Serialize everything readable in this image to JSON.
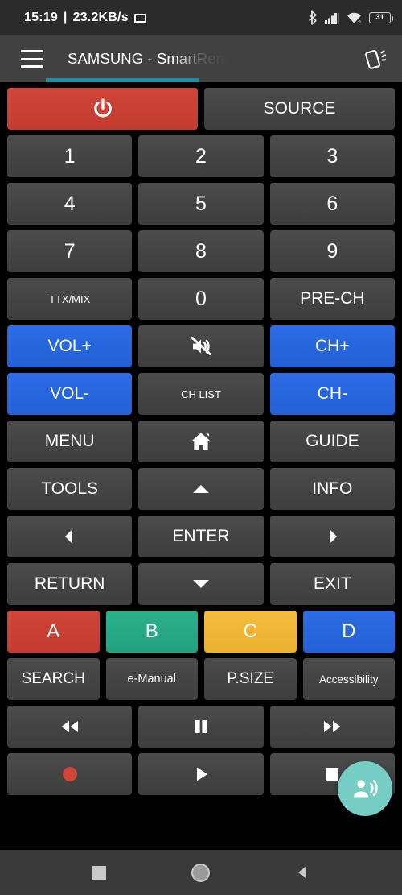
{
  "status_bar": {
    "time": "15:19",
    "separator": "|",
    "network_speed": "23.2KB/s",
    "screen_icon": "screen-cast-icon",
    "bluetooth_icon": "bluetooth-icon",
    "signal_icon": "cellular-signal-icon",
    "wifi_icon": "wifi-icon",
    "battery_level": "31"
  },
  "toolbar": {
    "menu_icon": "hamburger-menu-icon",
    "title": "SAMSUNG - SmartRem",
    "action_icon": "remote-cards-icon",
    "tab_indicator_color": "#1d8fa8"
  },
  "colors": {
    "background": "#000000",
    "button": "#474747",
    "red": "#c93f33",
    "blue": "#2765dd",
    "green": "#27a884",
    "yellow": "#efb536",
    "fab": "#76cdc3",
    "accent": "#1d8fa8"
  },
  "remote": {
    "rows": [
      {
        "name": "power-source-row",
        "buttons": [
          {
            "name": "power-button",
            "label": "",
            "icon": "power-icon",
            "style": "red",
            "flex": 2
          },
          {
            "name": "source-button",
            "label": "SOURCE",
            "icon": "",
            "style": "gray",
            "flex": 2
          }
        ]
      },
      {
        "name": "number-row-1",
        "buttons": [
          {
            "name": "number-1-button",
            "label": "1",
            "icon": "",
            "style": "num"
          },
          {
            "name": "number-2-button",
            "label": "2",
            "icon": "",
            "style": "num"
          },
          {
            "name": "number-3-button",
            "label": "3",
            "icon": "",
            "style": "num"
          }
        ]
      },
      {
        "name": "number-row-2",
        "buttons": [
          {
            "name": "number-4-button",
            "label": "4",
            "icon": "",
            "style": "num"
          },
          {
            "name": "number-5-button",
            "label": "5",
            "icon": "",
            "style": "num"
          },
          {
            "name": "number-6-button",
            "label": "6",
            "icon": "",
            "style": "num"
          }
        ]
      },
      {
        "name": "number-row-3",
        "buttons": [
          {
            "name": "number-7-button",
            "label": "7",
            "icon": "",
            "style": "num"
          },
          {
            "name": "number-8-button",
            "label": "8",
            "icon": "",
            "style": "num"
          },
          {
            "name": "number-9-button",
            "label": "9",
            "icon": "",
            "style": "num"
          }
        ]
      },
      {
        "name": "number-row-4",
        "buttons": [
          {
            "name": "ttx-mix-button",
            "label": "TTX/MIX",
            "icon": "",
            "style": "small"
          },
          {
            "name": "number-0-button",
            "label": "0",
            "icon": "",
            "style": "num"
          },
          {
            "name": "pre-ch-button",
            "label": "PRE-CH",
            "icon": "",
            "style": "gray"
          }
        ]
      },
      {
        "name": "volume-mute-channel-row-1",
        "buttons": [
          {
            "name": "volume-up-button",
            "label": "VOL+",
            "icon": "",
            "style": "blue"
          },
          {
            "name": "mute-button",
            "label": "",
            "icon": "mute-icon",
            "style": "gray"
          },
          {
            "name": "channel-up-button",
            "label": "CH+",
            "icon": "",
            "style": "blue"
          }
        ]
      },
      {
        "name": "volume-chlist-channel-row-2",
        "buttons": [
          {
            "name": "volume-down-button",
            "label": "VOL-",
            "icon": "",
            "style": "blue"
          },
          {
            "name": "channel-list-button",
            "label": "CH LIST",
            "icon": "",
            "style": "small"
          },
          {
            "name": "channel-down-button",
            "label": "CH-",
            "icon": "",
            "style": "blue"
          }
        ]
      },
      {
        "name": "menu-home-guide-row",
        "buttons": [
          {
            "name": "menu-button",
            "label": "MENU",
            "icon": "",
            "style": "gray"
          },
          {
            "name": "home-button",
            "label": "",
            "icon": "home-icon",
            "style": "gray"
          },
          {
            "name": "guide-button",
            "label": "GUIDE",
            "icon": "",
            "style": "gray"
          }
        ]
      },
      {
        "name": "tools-up-info-row",
        "buttons": [
          {
            "name": "tools-button",
            "label": "TOOLS",
            "icon": "",
            "style": "gray"
          },
          {
            "name": "arrow-up-button",
            "label": "",
            "icon": "arrow-up-icon",
            "style": "gray"
          },
          {
            "name": "info-button",
            "label": "INFO",
            "icon": "",
            "style": "gray"
          }
        ]
      },
      {
        "name": "left-enter-right-row",
        "buttons": [
          {
            "name": "arrow-left-button",
            "label": "",
            "icon": "arrow-left-icon",
            "style": "gray"
          },
          {
            "name": "enter-button",
            "label": "ENTER",
            "icon": "",
            "style": "gray"
          },
          {
            "name": "arrow-right-button",
            "label": "",
            "icon": "arrow-right-icon",
            "style": "gray"
          }
        ]
      },
      {
        "name": "return-down-exit-row",
        "buttons": [
          {
            "name": "return-button",
            "label": "RETURN",
            "icon": "",
            "style": "gray"
          },
          {
            "name": "arrow-down-button",
            "label": "",
            "icon": "arrow-down-icon",
            "style": "gray"
          },
          {
            "name": "exit-button",
            "label": "EXIT",
            "icon": "",
            "style": "gray"
          }
        ]
      },
      {
        "name": "color-buttons-row",
        "buttons": [
          {
            "name": "color-a-button",
            "label": "A",
            "icon": "",
            "style": "red-color"
          },
          {
            "name": "color-b-button",
            "label": "B",
            "icon": "",
            "style": "green-color"
          },
          {
            "name": "color-c-button",
            "label": "C",
            "icon": "",
            "style": "yellow-color"
          },
          {
            "name": "color-d-button",
            "label": "D",
            "icon": "",
            "style": "blue-color"
          }
        ]
      },
      {
        "name": "search-emanual-psize-accessibility-row",
        "buttons": [
          {
            "name": "search-button",
            "label": "SEARCH",
            "icon": "",
            "style": "mid"
          },
          {
            "name": "e-manual-button",
            "label": "e-Manual",
            "icon": "",
            "style": "small"
          },
          {
            "name": "picture-size-button",
            "label": "P.SIZE",
            "icon": "",
            "style": "mid"
          },
          {
            "name": "accessibility-button",
            "label": "Accessibility",
            "icon": "",
            "style": "small"
          }
        ]
      },
      {
        "name": "media-transport-row-1",
        "buttons": [
          {
            "name": "rewind-button",
            "label": "",
            "icon": "rewind-icon",
            "style": "gray"
          },
          {
            "name": "pause-button",
            "label": "",
            "icon": "pause-icon",
            "style": "gray"
          },
          {
            "name": "fast-forward-button",
            "label": "",
            "icon": "fast-forward-icon",
            "style": "gray"
          }
        ]
      },
      {
        "name": "media-transport-row-2",
        "buttons": [
          {
            "name": "record-button",
            "label": "",
            "icon": "record-icon",
            "style": "gray"
          },
          {
            "name": "play-button",
            "label": "",
            "icon": "play-icon",
            "style": "gray"
          },
          {
            "name": "stop-button",
            "label": "",
            "icon": "stop-icon",
            "style": "gray"
          }
        ]
      }
    ],
    "fab": {
      "name": "voice-command-fab",
      "icon": "record-voice-over-icon"
    }
  },
  "nav_bar": {
    "recents_icon": "recents-square-icon",
    "home_icon": "home-circle-icon",
    "back_icon": "back-triangle-icon"
  }
}
